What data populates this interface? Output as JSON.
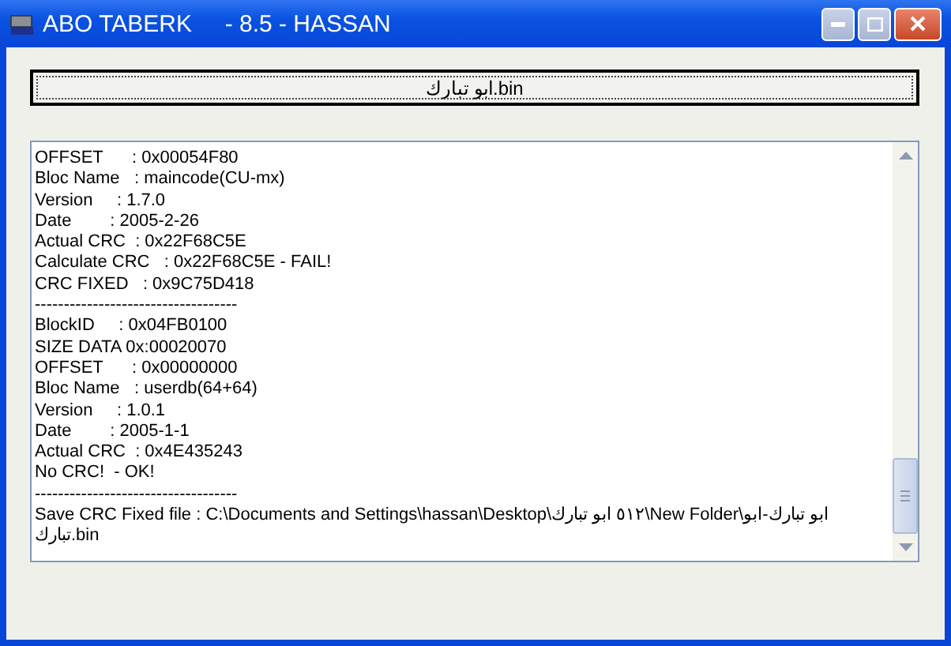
{
  "window": {
    "title": "ABO TABERK     - 8.5 - HASSAN"
  },
  "file_button": {
    "label": "ابو تبارك.bin"
  },
  "log": {
    "lines": [
      "OFFSET      : 0x00054F80",
      "Bloc Name   : maincode(CU-mx)",
      "Version     : 1.7.0",
      "Date        : 2005-2-26",
      "Actual CRC  : 0x22F68C5E",
      "Calculate CRC   : 0x22F68C5E - FAIL!",
      "CRC FIXED   : 0x9C75D418",
      "-----------------------------------",
      "BlockID     : 0x04FB0100",
      "SIZE DATA 0x:00020070",
      "OFFSET      : 0x00000000",
      "Bloc Name   : userdb(64+64)",
      "Version     : 1.0.1",
      "Date        : 2005-1-1",
      "Actual CRC  : 0x4E435243",
      "No CRC!  - OK!",
      "-----------------------------------",
      "Save CRC Fixed file : C:\\Documents and Settings\\hassan\\Desktop\\٥١٢ ابو تبارك\\New Folder\\ابو تبارك-ابو تبارك.bin"
    ]
  }
}
